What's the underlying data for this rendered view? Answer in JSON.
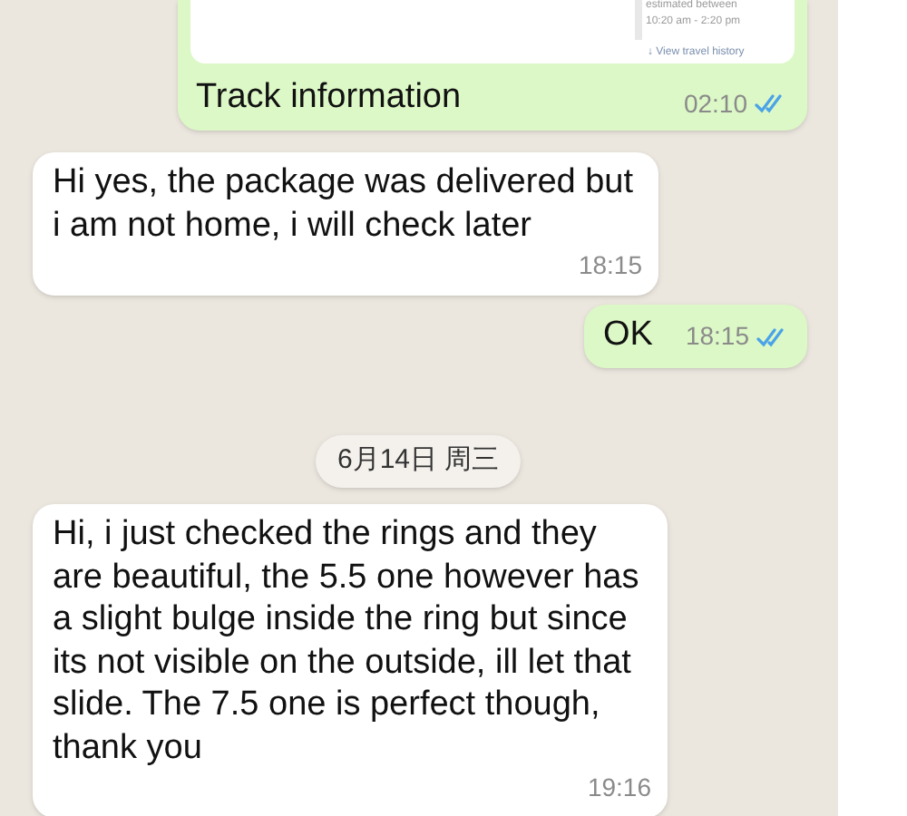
{
  "messages": [
    {
      "kind": "attachment",
      "outgoing": true,
      "card": {
        "estimate_label": "estimated between",
        "estimate_time": "10:20 am - 2:20 pm",
        "link": "↓ View travel history"
      },
      "text": "Track information",
      "time": "02:10",
      "read": true
    },
    {
      "kind": "text",
      "outgoing": false,
      "text": "Hi yes, the package was delivered but i am not home, i will check later",
      "time": "18:15"
    },
    {
      "kind": "text",
      "outgoing": true,
      "text": "OK",
      "time": "18:15",
      "read": true
    },
    {
      "kind": "date",
      "text": "6月14日 周三"
    },
    {
      "kind": "text",
      "outgoing": false,
      "text": "Hi, i just checked the rings and they are beautiful, the 5.5 one however has a slight bulge inside the ring but since its not visible on the outside, ill let that slide. The 7.5 one is perfect though, thank you",
      "time": "19:16"
    }
  ]
}
